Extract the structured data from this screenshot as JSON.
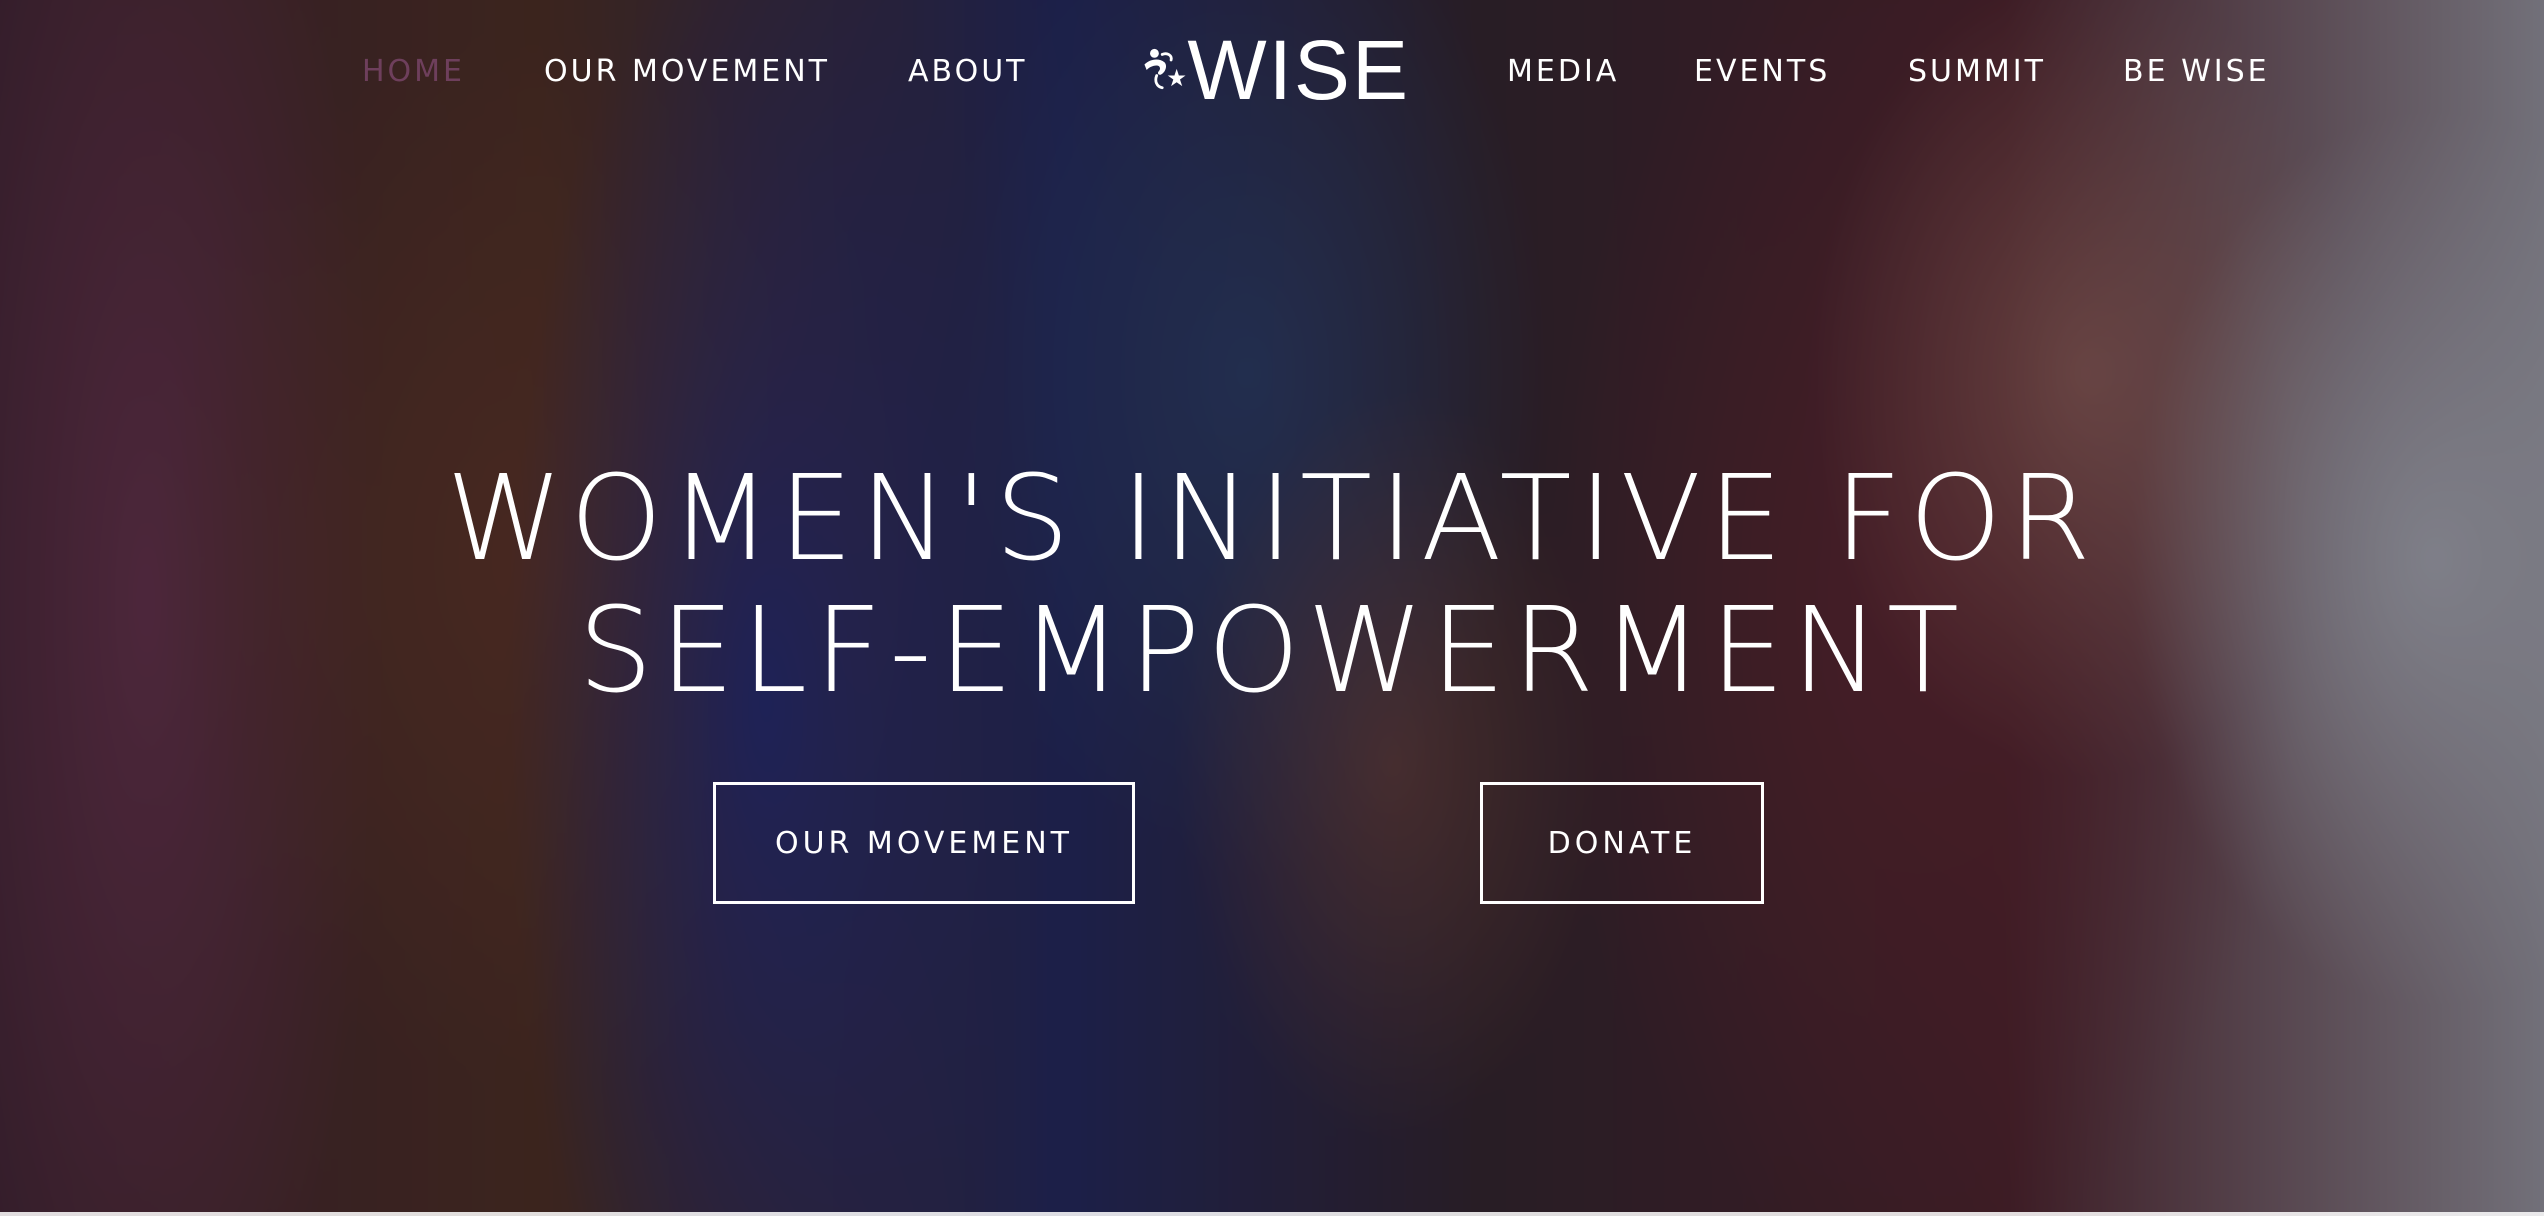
{
  "brand": {
    "logo_text": "WISE",
    "logo_icon": "dancing-figure-star-logo-icon"
  },
  "nav": {
    "items": [
      {
        "label": "HOME",
        "active": true
      },
      {
        "label": "OUR MOVEMENT",
        "active": false
      },
      {
        "label": "ABOUT",
        "active": false
      },
      {
        "label": "MEDIA",
        "active": false
      },
      {
        "label": "EVENTS",
        "active": false
      },
      {
        "label": "SUMMIT",
        "active": false
      },
      {
        "label": "BE WISE",
        "active": false
      }
    ]
  },
  "hero": {
    "headline_line1": "WOMEN'S INITIATIVE FOR",
    "headline_line2": "SELF-EMPOWERMENT",
    "primary_button": "OUR MOVEMENT",
    "secondary_button": "DONATE"
  },
  "colors": {
    "text": "#ffffff",
    "active_nav": "#6e3f5c",
    "overlay": "#0a060e"
  }
}
